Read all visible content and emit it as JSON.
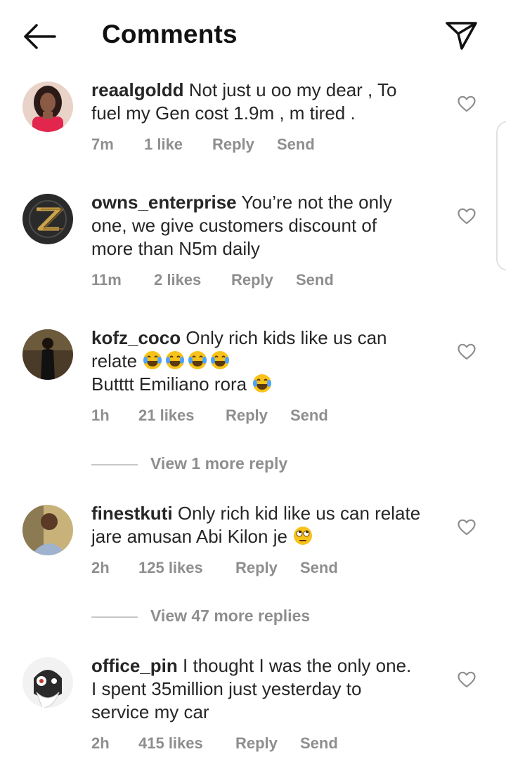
{
  "header": {
    "title": "Comments"
  },
  "comments": [
    {
      "user": "reaalgoldd",
      "text": "Not just u oo my dear , To\nfuel my Gen cost 1.9m , m tired .",
      "time": "7m",
      "likes": "1 like",
      "reply": "Reply",
      "send": "Send"
    },
    {
      "user": "owns_enterprise",
      "text": "You’re not the only\none, we give customers discount of\nmore than N5m daily",
      "time": "11m",
      "likes": "2 likes",
      "reply": "Reply",
      "send": "Send"
    },
    {
      "user": "kofz_coco",
      "text1": "Only rich kids like us can\nrelate",
      "text2": "Butttt Emiliano rora",
      "time": "1h",
      "likes": "21 likes",
      "reply": "Reply",
      "send": "Send"
    },
    {
      "user": "finestkuti",
      "text1": "Only rich kid like us can relate\njare amusan Abi Kilon je",
      "time": "2h",
      "likes": "125 likes",
      "reply": "Reply",
      "send": "Send"
    },
    {
      "user": "office_pin",
      "text": "I thought I was the only one.\nI spent 35million just yesterday to\nservice my car",
      "time": "2h",
      "likes": "415 likes",
      "reply": "Reply",
      "send": "Send"
    }
  ],
  "view_replies": [
    {
      "label": "View 1 more reply"
    },
    {
      "label": "View 47 more replies"
    }
  ],
  "icons": {
    "back": "arrow-left-icon",
    "send": "paper-plane-icon",
    "like": "heart-outline-icon",
    "emoji_laugh": "tears-of-joy-emoji",
    "emoji_eyeroll": "eye-roll-emoji"
  },
  "colors": {
    "text": "#262626",
    "meta": "#8e8e8e",
    "emoji": "#f7c21a"
  }
}
